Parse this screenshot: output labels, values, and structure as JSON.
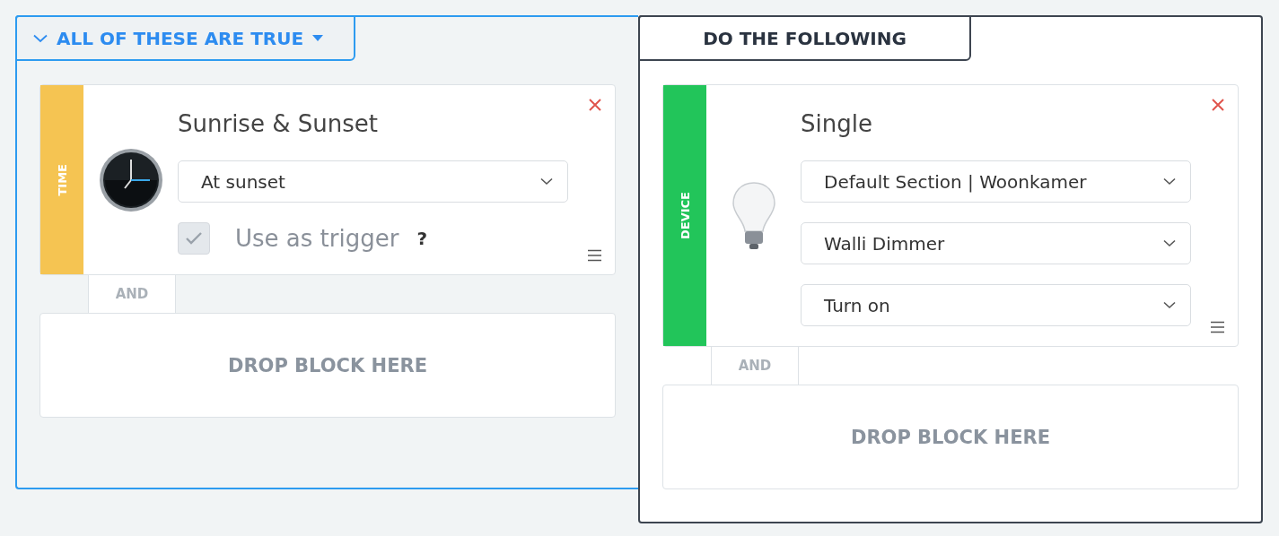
{
  "panels": [
    {
      "kind": "conditions",
      "header": {
        "label": "ALL OF THESE ARE TRUE",
        "expanded": true
      },
      "blocks": [
        {
          "kind": "time",
          "category": "TIME",
          "color": "#f5c452",
          "title": "Sunrise & Sunset",
          "selects": [
            "At sunset"
          ],
          "trigger": {
            "label": "Use as trigger",
            "checked": true,
            "disabled": true
          },
          "help": "?"
        }
      ],
      "connector": "AND",
      "drop_zone": "DROP BLOCK HERE"
    },
    {
      "kind": "actions",
      "header": {
        "label": "DO THE FOLLOWING"
      },
      "blocks": [
        {
          "kind": "device",
          "category": "DEVICE",
          "color": "#22c55a",
          "title": "Single",
          "selects": [
            "Default Section | Woonkamer",
            "Walli Dimmer",
            "Turn on"
          ]
        }
      ],
      "connector": "AND",
      "drop_zone": "DROP BLOCK HERE"
    }
  ]
}
